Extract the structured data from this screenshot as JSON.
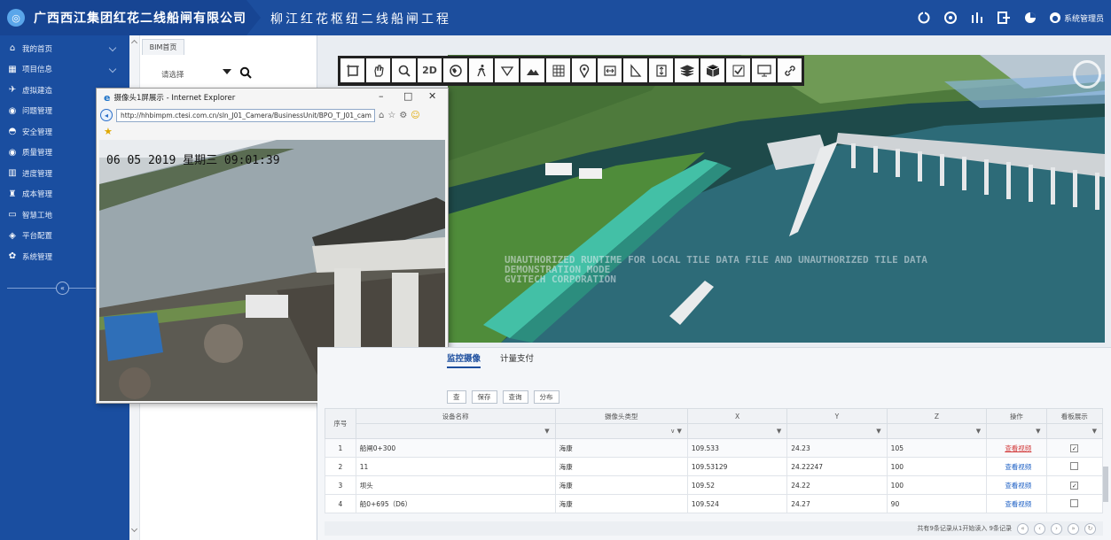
{
  "header": {
    "company": "广西西江集团红花二线船闸有限公司",
    "project": "柳江红花枢纽二线船闸工程",
    "user": "系统管理员"
  },
  "sidebar": {
    "items": [
      {
        "label": "我的首页",
        "icon": "home-icon"
      },
      {
        "label": "项目信息",
        "icon": "grid-icon"
      },
      {
        "label": "虚拟建造",
        "icon": "rocket-icon"
      },
      {
        "label": "问题管理",
        "icon": "target-icon"
      },
      {
        "label": "安全管理",
        "icon": "helmet-icon"
      },
      {
        "label": "质量管理",
        "icon": "badge-icon"
      },
      {
        "label": "进度管理",
        "icon": "chart-icon"
      },
      {
        "label": "成本管理",
        "icon": "money-icon"
      },
      {
        "label": "智慧工地",
        "icon": "monitor-icon"
      },
      {
        "label": "平台配置",
        "icon": "shield-icon"
      },
      {
        "label": "系统管理",
        "icon": "gear-icon"
      }
    ],
    "collapse": "«"
  },
  "tree": {
    "tab": "BIM首页",
    "select_placeholder": "请选择"
  },
  "toolbar": {
    "tools": [
      "frame-icon",
      "hand-icon",
      "search-icon",
      "2D",
      "globe-icon",
      "walk-icon",
      "triangle-icon",
      "mountain-icon",
      "grid-icon",
      "pin-icon",
      "measure-icon",
      "angle-icon",
      "height-icon",
      "layers-icon",
      "box-icon",
      "check-icon",
      "screen-icon",
      "link-icon"
    ]
  },
  "viewport": {
    "watermark": [
      "UNAUTHORIZED RUNTIME FOR LOCAL TILE DATA FILE AND UNAUTHORIZED TILE DATA",
      "DEMONSTRATION MODE",
      "GVITECH CORPORATION"
    ]
  },
  "ie": {
    "title": "摄像头1屏展示 - Internet Explorer",
    "url": "http://hhbimpm.ctesi.com.cn/sln_J01_Camera/BusinessUnit/BPO_T_J01_cam",
    "stamp": "06 05 2019 星期三 09:01:39"
  },
  "lower": {
    "tabs": [
      "监控摄像",
      "计量支付"
    ],
    "buttons": [
      "查",
      "保存",
      "查询",
      "分布"
    ],
    "columns": [
      "序号",
      "设备名称",
      "摄像头类型",
      "X",
      "Y",
      "Z",
      "操作",
      "看板展示"
    ],
    "rows": [
      {
        "no": "1",
        "name": "船闸0+300",
        "type": "海康",
        "x": "109.533",
        "y": "24.23",
        "z": "105",
        "action": "查看视频",
        "show": "✓"
      },
      {
        "no": "2",
        "name": "11",
        "type": "海康",
        "x": "109.53129",
        "y": "24.22247",
        "z": "100",
        "action": "查看视频",
        "show": ""
      },
      {
        "no": "3",
        "name": "坝头",
        "type": "海康",
        "x": "109.52",
        "y": "24.22",
        "z": "100",
        "action": "查看视频",
        "show": "✓"
      },
      {
        "no": "4",
        "name": "船0+695（D6）",
        "type": "海康",
        "x": "109.524",
        "y": "24.27",
        "z": "90",
        "action": "查看视频",
        "show": ""
      }
    ],
    "pager_text": "共有9条记录从1开始读入 9条记录"
  }
}
